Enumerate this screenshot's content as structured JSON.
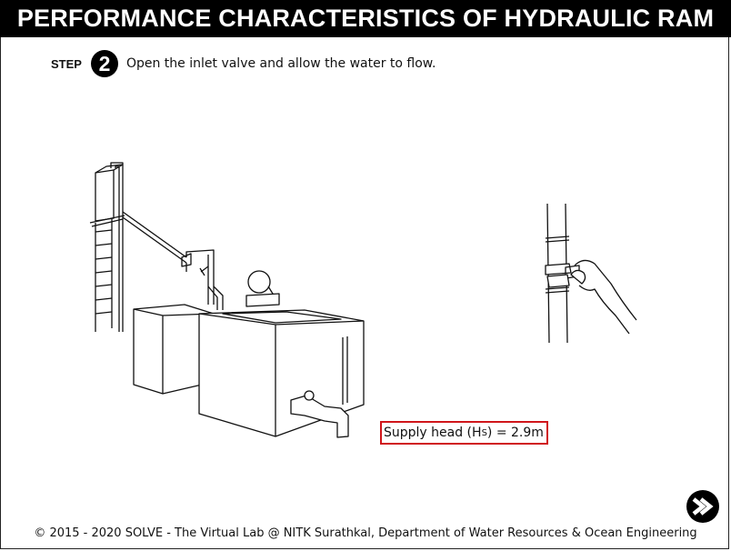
{
  "header": {
    "title": "PERFORMANCE CHARACTERISTICS OF HYDRAULIC RAM"
  },
  "step": {
    "label": "STEP",
    "number": "2",
    "instruction": "Open the inlet valve and allow the water to flow."
  },
  "readout": {
    "prefix": "Supply head (H",
    "subscript": "S",
    "suffix": ") = 2.9m"
  },
  "navigation": {
    "next_icon": "next-arrow-icon"
  },
  "footer": {
    "text": "© 2015 - 2020 SOLVE - The Virtual Lab @ NITK Surathkal, Department of Water Resources & Ocean Engineering"
  },
  "colors": {
    "title_bg": "#000000",
    "title_fg": "#ffffff",
    "readout_border": "#d0161b"
  }
}
